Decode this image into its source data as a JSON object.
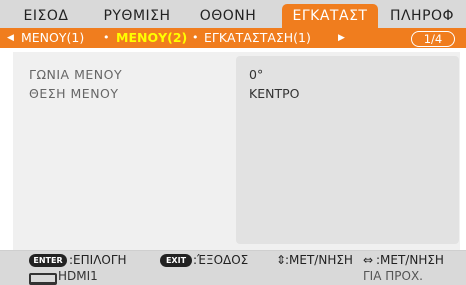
{
  "tabs": [
    "ΕΙΣΟΔ",
    "ΡΥΘΜΙΣΗ",
    "ΟΘΟΝΗ",
    "ΕΓΚΑΤΑΣΤ",
    "ΠΛΗΡΟΦ"
  ],
  "active_tab_index": 3,
  "subtabs": {
    "left_arrow": "◀",
    "right_arrow": "▶",
    "items": [
      "ΜΕΝΟΥ(1)",
      "ΜΕΝΟΥ(2)",
      "ΕΓΚΑΤΑΣΤΑΣΗ(1)"
    ],
    "separator": "•",
    "current_index": 1,
    "page": "1/4"
  },
  "settings": [
    {
      "label": "ΓΩΝΙΑ ΜΕΝΟΥ",
      "value": "0°"
    },
    {
      "label": "ΘΕΣΗ ΜΕΝΟΥ",
      "value": "ΚΕΝΤΡΟ"
    }
  ],
  "footer": {
    "enter_key": "ENTER",
    "enter_text": ":ΕΠΙΛΟΓΗ",
    "exit_key": "EXIT",
    "exit_text": ":ΈΞΟΔΟΣ",
    "ud_icon": "⇕",
    "ud_text": ":ΜΕΤ/ΝΗΣΗ",
    "lr_icon": "⇔",
    "lr_text": ":ΜΕΤ/ΝΗΣΗ"
  },
  "status": {
    "source_icon": "hdmi-connector-icon",
    "source": "HDMI1",
    "right": "ΓΙΑ ΠΡΟΧ."
  },
  "colors": {
    "accent": "#f07d1e",
    "current_subtab": "#ffff00"
  }
}
